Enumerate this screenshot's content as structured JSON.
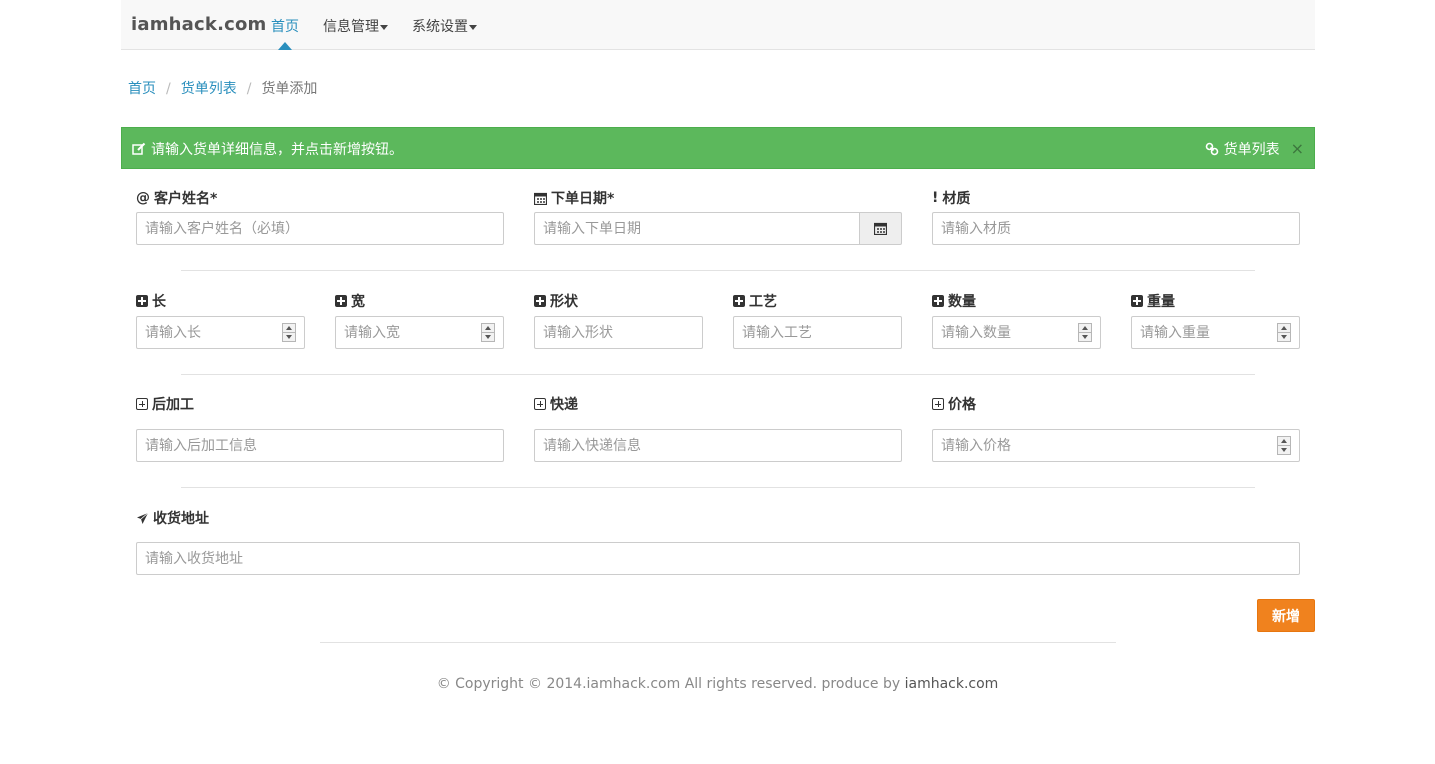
{
  "navbar": {
    "brand": "iamhack.com",
    "items": [
      {
        "label": "首页",
        "active": true
      },
      {
        "label": "信息管理",
        "dropdown": true
      },
      {
        "label": "系统设置",
        "dropdown": true
      }
    ]
  },
  "breadcrumb": {
    "items": [
      "首页",
      "货单列表"
    ],
    "current": "货单添加"
  },
  "alert": {
    "message": "请输入货单详细信息，并点击新增按钮。",
    "link_label": "货单列表",
    "close": "×",
    "color": "#5cb85c"
  },
  "form": {
    "customer": {
      "label": "客户姓名*",
      "prefix": "@",
      "placeholder": "请输入客户姓名（必填）"
    },
    "order_date": {
      "label": "下单日期*",
      "placeholder": "请输入下单日期"
    },
    "material": {
      "label": "材质",
      "prefix": "!",
      "placeholder": "请输入材质"
    },
    "length": {
      "label": "长",
      "placeholder": "请输入长"
    },
    "width": {
      "label": "宽",
      "placeholder": "请输入宽"
    },
    "shape": {
      "label": "形状",
      "placeholder": "请输入形状"
    },
    "craft": {
      "label": "工艺",
      "placeholder": "请输入工艺"
    },
    "quantity": {
      "label": "数量",
      "placeholder": "请输入数量"
    },
    "weight": {
      "label": "重量",
      "placeholder": "请输入重量"
    },
    "post_process": {
      "label": "后加工",
      "placeholder": "请输入后加工信息"
    },
    "express": {
      "label": "快递",
      "placeholder": "请输入快递信息"
    },
    "price": {
      "label": "价格",
      "placeholder": "请输入价格"
    },
    "address": {
      "label": "收货地址",
      "placeholder": "请输入收货地址"
    },
    "submit_label": "新增",
    "submit_color": "#f0821e"
  },
  "footer": {
    "text": "© Copyright © 2014.iamhack.com All rights reserved. produce by ",
    "brand": "iamhack.com"
  }
}
